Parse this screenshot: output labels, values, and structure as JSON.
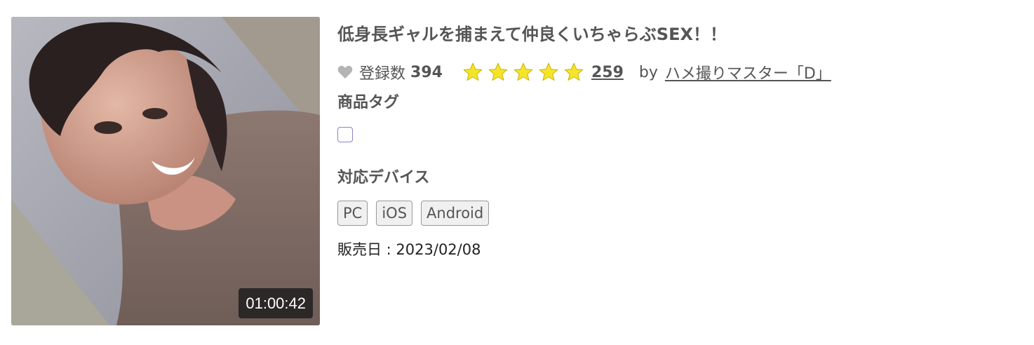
{
  "product": {
    "title": "低身長ギャルを捕まえて仲良くいちゃらぶSEX！！",
    "duration": "01:00:42",
    "favorites": {
      "icon": "heart-icon",
      "label": "登録数",
      "count": "394"
    },
    "rating": {
      "stars": 5,
      "max": 5,
      "star_color": "#f5e52a",
      "review_count": "259"
    },
    "seller": {
      "prefix": "by",
      "name": "ハメ撮りマスター「D」"
    },
    "tags": {
      "label": "商品タグ"
    },
    "devices": {
      "label": "対応デバイス",
      "items": [
        "PC",
        "iOS",
        "Android"
      ]
    },
    "release": "販売日 : 2023/02/08"
  }
}
